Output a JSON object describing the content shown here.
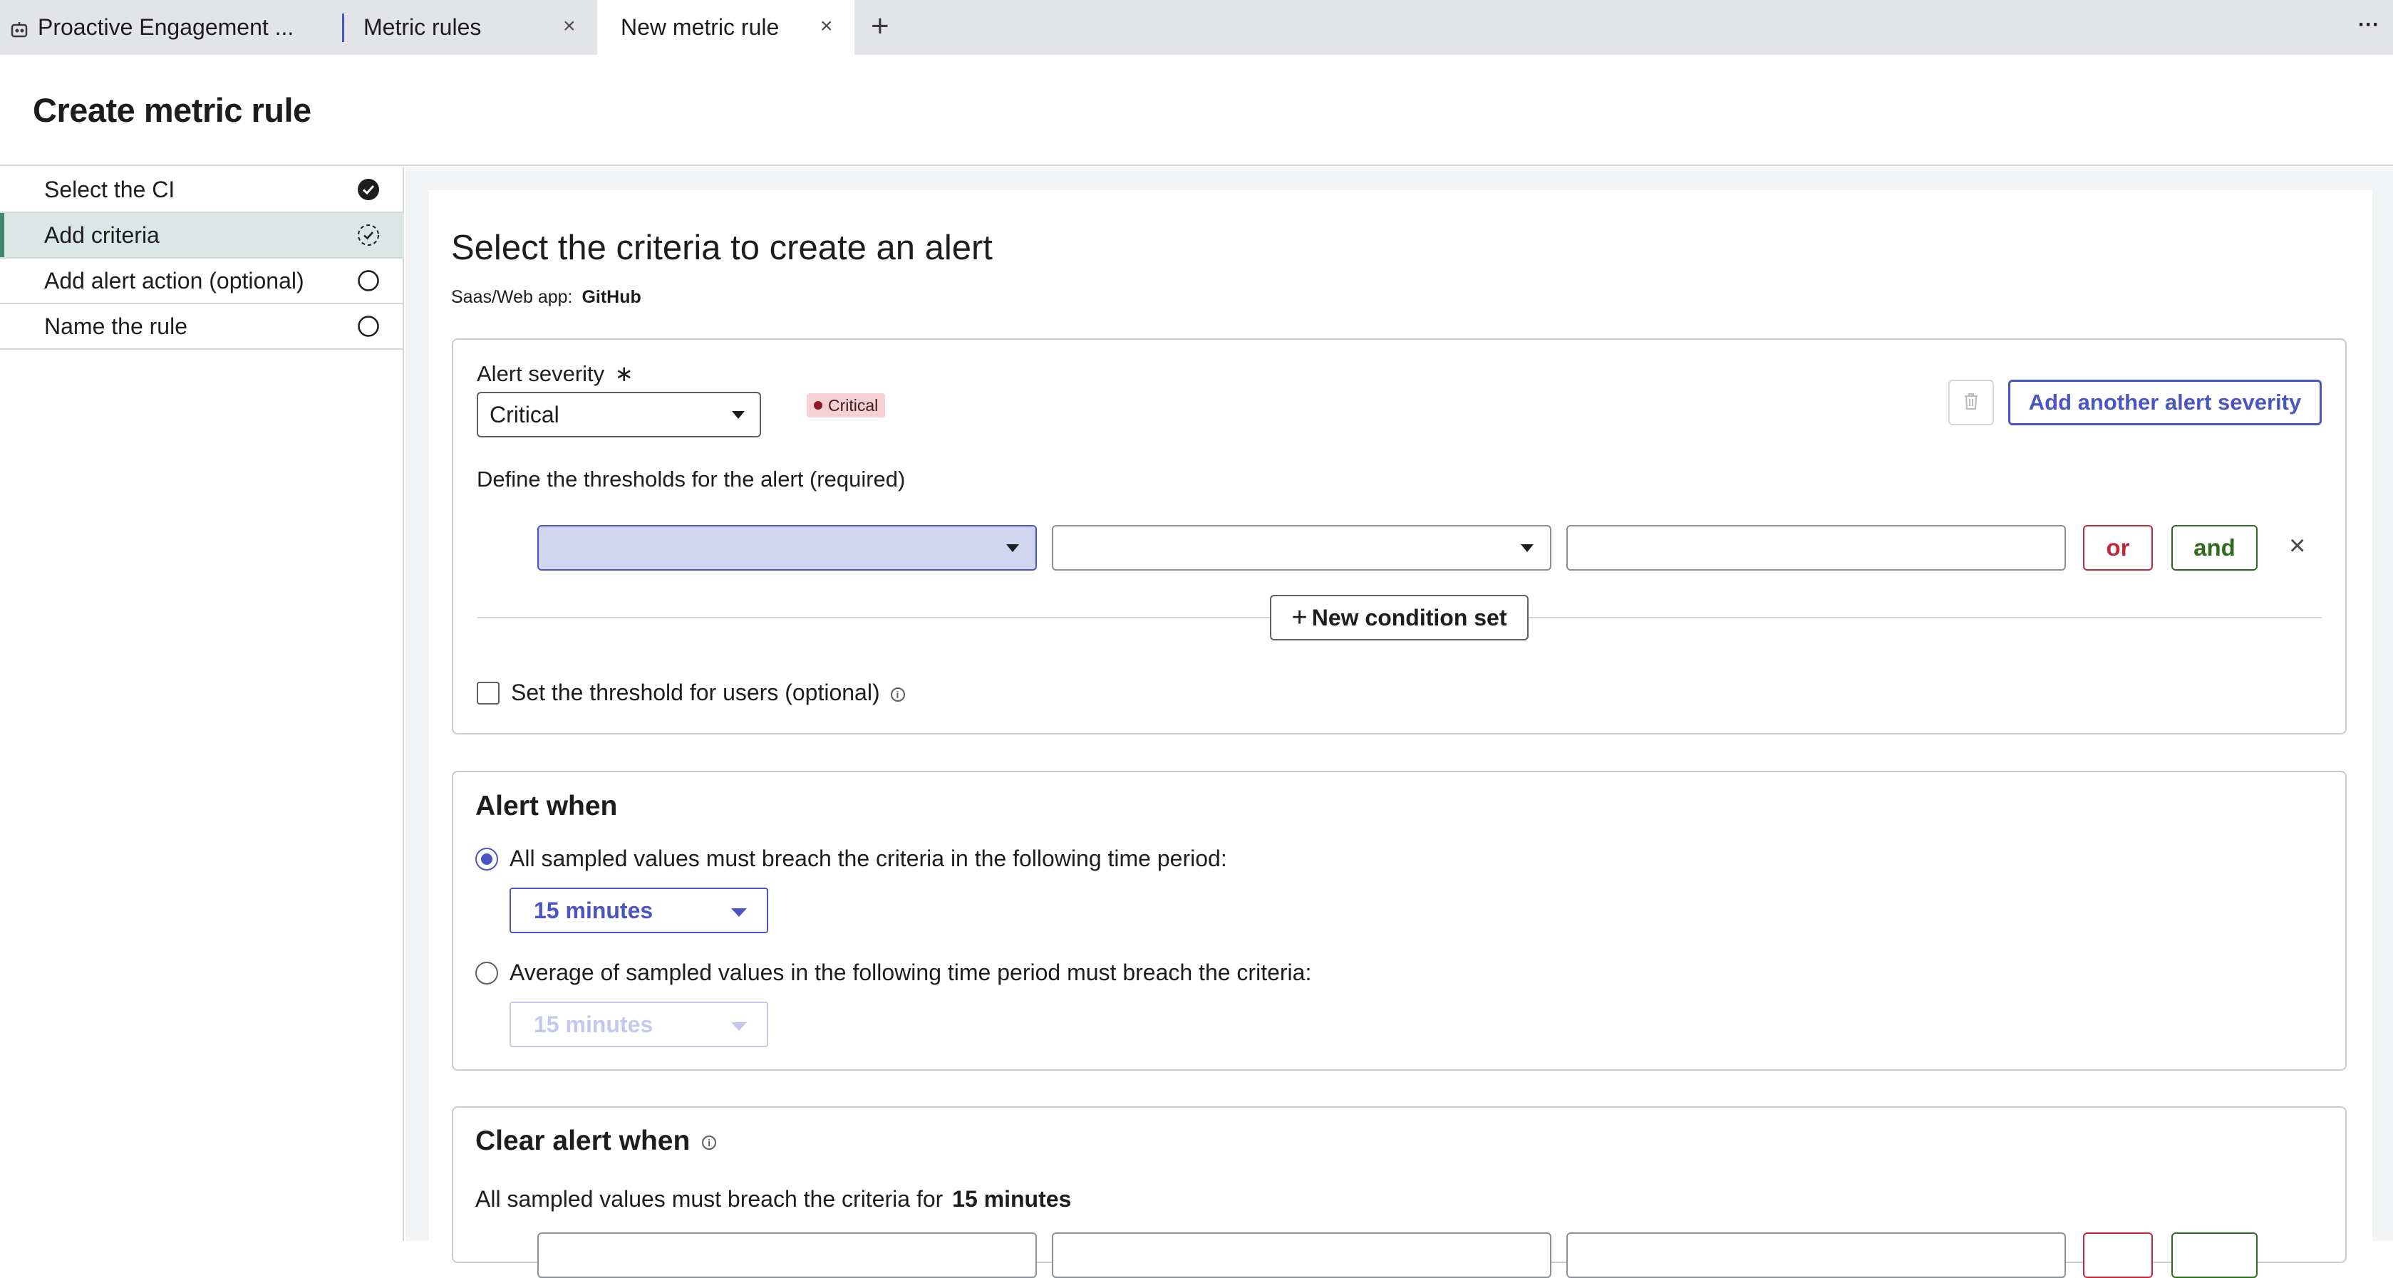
{
  "tabs": [
    {
      "label": "Proactive Engagement ...",
      "icon": "workspace-icon"
    },
    {
      "label": "Metric rules",
      "close": "×"
    },
    {
      "label": "New metric rule",
      "close": "×",
      "active": true
    }
  ],
  "tabbar": {
    "add": "+",
    "more": "···"
  },
  "page": {
    "title": "Create metric rule"
  },
  "sidebar": {
    "steps": [
      {
        "label": "Select the CI",
        "status": "complete"
      },
      {
        "label": "Add criteria",
        "status": "in-progress"
      },
      {
        "label": "Add alert action (optional)",
        "status": "not-started"
      },
      {
        "label": "Name the rule",
        "status": "not-started"
      }
    ]
  },
  "main": {
    "heading": "Select the criteria to create an alert",
    "subtitle_label": "Saas/Web app:",
    "subtitle_value": "GitHub"
  },
  "severity": {
    "label": "Alert severity",
    "required_mark": "∗",
    "value": "Critical",
    "badge": "Critical",
    "add_button": "Add another alert severity"
  },
  "thresholds": {
    "label": "Define the thresholds for the alert (required)",
    "or_label": "or",
    "and_label": "and",
    "remove": "×",
    "new_condition_set": "New condition set",
    "plus": "+",
    "users_checkbox": "Set the threshold for users (optional)"
  },
  "alert_when": {
    "title": "Alert when",
    "option1": "All sampled values must breach the criteria in the following time period:",
    "option1_value": "15 minutes",
    "option2": "Average of sampled values in the following time period must breach the criteria:",
    "option2_value": "15 minutes"
  },
  "clear_alert": {
    "title": "Clear alert when",
    "text": "All sampled values must breach the criteria for",
    "duration": "15 minutes"
  },
  "colors": {
    "accent": "#4a55c4",
    "or": "#c2263b",
    "and": "#2e6b1f",
    "badge_bg": "#f6d0d3",
    "active_step_bg": "#dbe7e4"
  }
}
